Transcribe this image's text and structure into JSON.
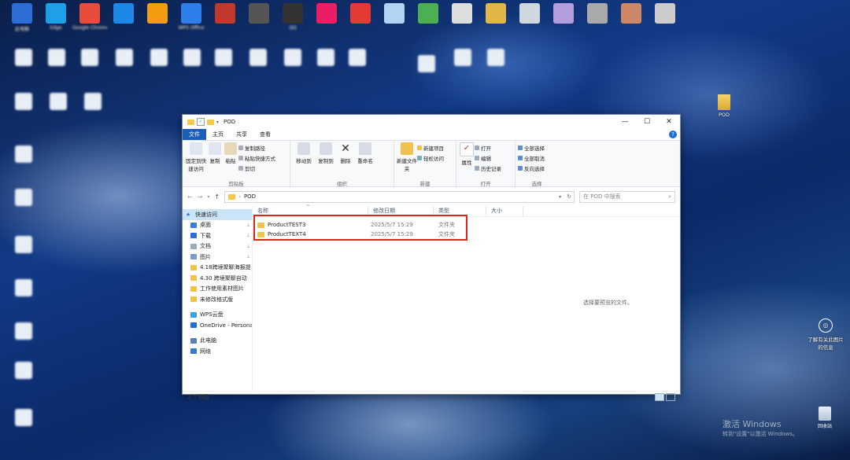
{
  "desktop": {
    "pod_icon_label": "POD",
    "notification": "了解有关此图片的信息",
    "activation_title": "激活 Windows",
    "activation_sub": "转到\"设置\"以激活 Windows。",
    "recycle_bin": "回收站",
    "row1_labels": [
      "此电脑",
      "Edge",
      "Google Chrome",
      "",
      "",
      "WPS Office",
      "",
      "",
      "QQ",
      "",
      "",
      "",
      "",
      "",
      "",
      "",
      "",
      "",
      "",
      ""
    ]
  },
  "window": {
    "title": "POD",
    "tabs": [
      "文件",
      "主页",
      "共享",
      "查看"
    ],
    "help": "?",
    "ribbon": {
      "clipboard": {
        "pin": "固定到快速访问",
        "copy": "复制",
        "paste": "粘贴",
        "copy_path": "复制路径",
        "paste_shortcut": "粘贴快捷方式",
        "cut": "剪切",
        "name": "剪贴板"
      },
      "organize": {
        "move": "移动到",
        "copyto": "复制到",
        "delete": "删除",
        "rename": "重命名",
        "name": "组织"
      },
      "new": {
        "new_folder": "新建文件夹",
        "new_item": "新建项目",
        "easy_access": "轻松访问",
        "name": "新建"
      },
      "open": {
        "properties": "属性",
        "open": "打开",
        "edit": "编辑",
        "history": "历史记录",
        "name": "打开"
      },
      "select": {
        "all": "全部选择",
        "none": "全部取消",
        "invert": "反向选择",
        "name": "选择"
      }
    },
    "address": {
      "path": "POD",
      "search_placeholder": "在 POD 中搜索"
    },
    "nav": [
      {
        "label": "快速访问",
        "type": "header"
      },
      {
        "label": "桌面",
        "pin": true
      },
      {
        "label": "下载",
        "pin": true
      },
      {
        "label": "文档",
        "pin": true
      },
      {
        "label": "图片",
        "pin": true
      },
      {
        "label": "4.18跨境聚聊海报提"
      },
      {
        "label": "4.30 跨境聚聊自动"
      },
      {
        "label": "工作使用素材图片"
      },
      {
        "label": "未修改格式版"
      },
      {
        "label": "WPS云盘"
      },
      {
        "label": "OneDrive - Persona"
      },
      {
        "label": "此电脑"
      },
      {
        "label": "网络"
      }
    ],
    "columns": [
      "名称",
      "修改日期",
      "类型",
      "大小"
    ],
    "files": [
      {
        "name": "ProductTEST3",
        "date": "2025/5/7 15:29",
        "type": "文件夹"
      },
      {
        "name": "ProductTEXT4",
        "date": "2025/5/7 15:29",
        "type": "文件夹"
      }
    ],
    "preview_text": "选择要预览的文件。",
    "status": "2 个项目"
  },
  "colors": {
    "accent": "#1c5fb8",
    "highlight": "#e2231a",
    "folder": "#f1c24b"
  }
}
